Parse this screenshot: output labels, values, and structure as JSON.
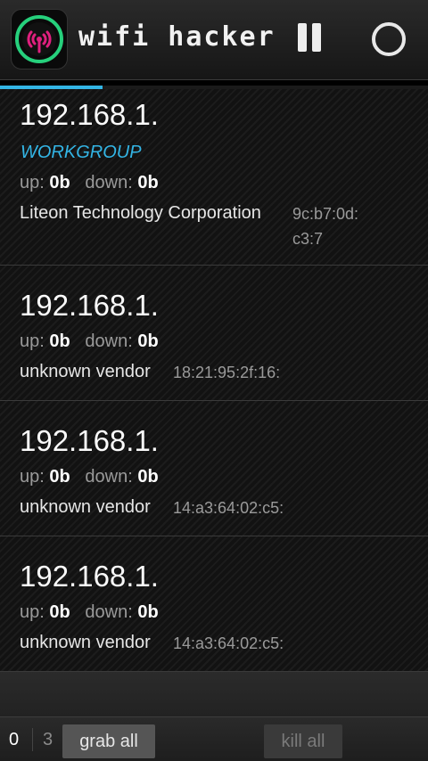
{
  "app": {
    "title": "wifi hacker",
    "icon": "wifi-antenna-icon",
    "accent_color": "#33b5e5",
    "progress": 0.24
  },
  "hosts": [
    {
      "ip": "192.168.1.",
      "workgroup": "WORKGROUP",
      "up_label": "up:",
      "up_value": "0b",
      "down_label": "down:",
      "down_value": "0b",
      "vendor": "Liteon Technology Corporation",
      "mac_line1": "9c:b7:0d:",
      "mac_line2": "c3:7"
    },
    {
      "ip": "192.168.1.",
      "up_label": "up:",
      "up_value": "0b",
      "down_label": "down:",
      "down_value": "0b",
      "vendor": "unknown vendor",
      "mac_line1": "18:21:95:2f:16:"
    },
    {
      "ip": "192.168.1.",
      "up_label": "up:",
      "up_value": "0b",
      "down_label": "down:",
      "down_value": "0b",
      "vendor": "unknown vendor",
      "mac_line1": "14:a3:64:02:c5:"
    },
    {
      "ip": "192.168.1.",
      "up_label": "up:",
      "up_value": "0b",
      "down_label": "down:",
      "down_value": "0b",
      "vendor": "unknown vendor",
      "mac_line1": "14:a3:64:02:c5:"
    }
  ],
  "bottombar": {
    "selected_count": "0",
    "total_count": "3",
    "grab_all_label": "grab all",
    "kill_all_label": "kill all"
  }
}
